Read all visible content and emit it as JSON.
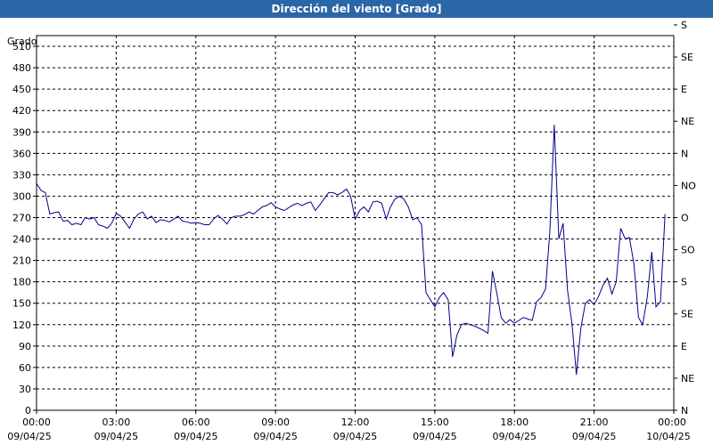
{
  "window": {
    "title": "Dirección del viento [Grado]"
  },
  "chart_data": {
    "type": "line",
    "title": "Dirección del viento [Grado]",
    "ylabel": "Grado",
    "ylim": [
      0,
      525
    ],
    "yticks": [
      0,
      30,
      60,
      90,
      120,
      150,
      180,
      210,
      240,
      270,
      300,
      330,
      360,
      390,
      420,
      450,
      480,
      510
    ],
    "right_ticks": [
      {
        "value": 0,
        "label": "N"
      },
      {
        "value": 45,
        "label": "NE"
      },
      {
        "value": 90,
        "label": "E"
      },
      {
        "value": 135,
        "label": "SE"
      },
      {
        "value": 180,
        "label": "S"
      },
      {
        "value": 225,
        "label": "SO"
      },
      {
        "value": 270,
        "label": "O"
      },
      {
        "value": 315,
        "label": "NO"
      },
      {
        "value": 360,
        "label": "N"
      },
      {
        "value": 405,
        "label": "NE"
      },
      {
        "value": 450,
        "label": "E"
      },
      {
        "value": 495,
        "label": "SE"
      },
      {
        "value": 540,
        "label": "S"
      }
    ],
    "xlim_hours": [
      0,
      24
    ],
    "xticks": [
      {
        "hour": 0,
        "time": "00:00",
        "date": "09/04/25"
      },
      {
        "hour": 3,
        "time": "03:00",
        "date": "09/04/25"
      },
      {
        "hour": 6,
        "time": "06:00",
        "date": "09/04/25"
      },
      {
        "hour": 9,
        "time": "09:00",
        "date": "09/04/25"
      },
      {
        "hour": 12,
        "time": "12:00",
        "date": "09/04/25"
      },
      {
        "hour": 15,
        "time": "15:00",
        "date": "09/04/25"
      },
      {
        "hour": 18,
        "time": "18:00",
        "date": "09/04/25"
      },
      {
        "hour": 21,
        "time": "21:00",
        "date": "09/04/25"
      },
      {
        "hour": 24,
        "time": "00:00",
        "date": "10/04/25"
      }
    ],
    "grid": true,
    "series": [
      {
        "color": "#00008b",
        "points": [
          [
            0,
            318
          ],
          [
            0.17,
            308
          ],
          [
            0.33,
            305
          ],
          [
            0.5,
            275
          ],
          [
            0.67,
            277
          ],
          [
            0.83,
            278
          ],
          [
            1,
            265
          ],
          [
            1.17,
            266
          ],
          [
            1.33,
            260
          ],
          [
            1.5,
            262
          ],
          [
            1.67,
            260
          ],
          [
            1.83,
            270
          ],
          [
            2,
            268
          ],
          [
            2.17,
            270
          ],
          [
            2.33,
            260
          ],
          [
            2.5,
            258
          ],
          [
            2.67,
            255
          ],
          [
            2.83,
            262
          ],
          [
            3,
            276
          ],
          [
            3.17,
            272
          ],
          [
            3.33,
            264
          ],
          [
            3.5,
            255
          ],
          [
            3.67,
            268
          ],
          [
            3.83,
            275
          ],
          [
            4,
            278
          ],
          [
            4.17,
            268
          ],
          [
            4.33,
            272
          ],
          [
            4.5,
            263
          ],
          [
            4.67,
            267
          ],
          [
            4.83,
            266
          ],
          [
            5,
            264
          ],
          [
            5.17,
            268
          ],
          [
            5.33,
            272
          ],
          [
            5.5,
            265
          ],
          [
            5.67,
            264
          ],
          [
            5.83,
            262
          ],
          [
            6,
            263
          ],
          [
            6.17,
            262
          ],
          [
            6.33,
            260
          ],
          [
            6.5,
            260
          ],
          [
            6.67,
            268
          ],
          [
            6.83,
            273
          ],
          [
            7,
            268
          ],
          [
            7.17,
            261
          ],
          [
            7.33,
            270
          ],
          [
            7.5,
            272
          ],
          [
            7.67,
            272
          ],
          [
            7.83,
            274
          ],
          [
            8,
            278
          ],
          [
            8.17,
            275
          ],
          [
            8.33,
            280
          ],
          [
            8.5,
            285
          ],
          [
            8.67,
            287
          ],
          [
            8.83,
            291
          ],
          [
            9,
            285
          ],
          [
            9.17,
            282
          ],
          [
            9.33,
            280
          ],
          [
            9.5,
            284
          ],
          [
            9.67,
            288
          ],
          [
            9.83,
            290
          ],
          [
            10,
            287
          ],
          [
            10.17,
            290
          ],
          [
            10.33,
            292
          ],
          [
            10.5,
            280
          ],
          [
            10.67,
            288
          ],
          [
            10.83,
            296
          ],
          [
            11,
            305
          ],
          [
            11.17,
            305
          ],
          [
            11.33,
            302
          ],
          [
            11.5,
            305
          ],
          [
            11.67,
            310
          ],
          [
            11.83,
            300
          ],
          [
            12,
            268
          ],
          [
            12.17,
            280
          ],
          [
            12.33,
            285
          ],
          [
            12.5,
            278
          ],
          [
            12.67,
            292
          ],
          [
            12.83,
            293
          ],
          [
            13,
            290
          ],
          [
            13.17,
            268
          ],
          [
            13.33,
            285
          ],
          [
            13.5,
            296
          ],
          [
            13.67,
            300
          ],
          [
            13.83,
            296
          ],
          [
            14,
            285
          ],
          [
            14.17,
            267
          ],
          [
            14.33,
            270
          ],
          [
            14.5,
            260
          ],
          [
            14.67,
            165
          ],
          [
            14.83,
            155
          ],
          [
            15,
            145
          ],
          [
            15.17,
            158
          ],
          [
            15.33,
            165
          ],
          [
            15.5,
            155
          ],
          [
            15.67,
            75
          ],
          [
            15.83,
            105
          ],
          [
            16,
            120
          ],
          [
            16.17,
            122
          ],
          [
            16.33,
            120
          ],
          [
            16.5,
            118
          ],
          [
            16.67,
            115
          ],
          [
            16.83,
            112
          ],
          [
            17,
            108
          ],
          [
            17.17,
            195
          ],
          [
            17.33,
            165
          ],
          [
            17.5,
            130
          ],
          [
            17.67,
            122
          ],
          [
            17.83,
            127
          ],
          [
            18,
            122
          ],
          [
            18.17,
            126
          ],
          [
            18.33,
            130
          ],
          [
            18.5,
            128
          ],
          [
            18.67,
            126
          ],
          [
            18.83,
            152
          ],
          [
            19,
            158
          ],
          [
            19.17,
            170
          ],
          [
            19.33,
            250
          ],
          [
            19.5,
            400
          ],
          [
            19.67,
            240
          ],
          [
            19.83,
            262
          ],
          [
            20,
            168
          ],
          [
            20.17,
            120
          ],
          [
            20.33,
            50
          ],
          [
            20.5,
            115
          ],
          [
            20.67,
            150
          ],
          [
            20.83,
            155
          ],
          [
            21,
            148
          ],
          [
            21.17,
            160
          ],
          [
            21.33,
            175
          ],
          [
            21.5,
            185
          ],
          [
            21.67,
            163
          ],
          [
            21.83,
            180
          ],
          [
            22,
            255
          ],
          [
            22.17,
            240
          ],
          [
            22.33,
            242
          ],
          [
            22.5,
            205
          ],
          [
            22.67,
            130
          ],
          [
            22.83,
            120
          ],
          [
            23,
            158
          ],
          [
            23.17,
            222
          ],
          [
            23.33,
            145
          ],
          [
            23.5,
            152
          ],
          [
            23.67,
            275
          ]
        ]
      }
    ]
  }
}
